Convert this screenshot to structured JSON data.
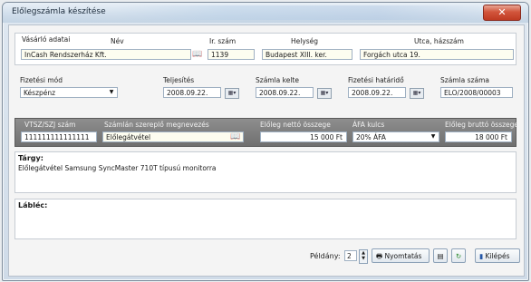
{
  "window": {
    "title": "Előlegszámla készítése",
    "close_glyph": "✕"
  },
  "buyer": {
    "section_label": "Vásárló adatai",
    "col_name": "Név",
    "col_zip": "Ir. szám",
    "col_city": "Helység",
    "col_street": "Utca, házszám",
    "name": "InCash Rendszerház Kft.",
    "zip": "1139",
    "city": "Budapest XIII. ker.",
    "street": "Forgách utca 19."
  },
  "payment": {
    "method_label": "Fizetési mód",
    "method_value": "Készpénz",
    "fulfillment_label": "Teljesítés",
    "fulfillment_value": "2008.09.22.",
    "issue_label": "Számla kelte",
    "issue_value": "2008.09.22.",
    "due_label": "Fizetési határidő",
    "due_value": "2008.09.22.",
    "number_label": "Számla száma",
    "number_value": "ELO/2008/00003"
  },
  "line": {
    "vtsz_label": "VTSZ/SZJ szám",
    "vtsz_value": "111111111111111",
    "desc_label": "Számlán szereplő megnevezés",
    "desc_value": "Előlegátvétel",
    "net_label": "Előleg nettó összege",
    "net_value": "15 000 Ft",
    "vat_label": "ÁFA kulcs",
    "vat_value": "20% ÁFA",
    "gross_label": "Előleg bruttó összege",
    "gross_value": "18 000 Ft"
  },
  "subject": {
    "label": "Tárgy:",
    "text": "Előlegátvétel Samsung SyncMaster 710T típusú monitorra"
  },
  "footer": {
    "label": "Lábléc:",
    "text": ""
  },
  "bottom": {
    "copies_label": "Példány:",
    "copies_value": "2",
    "print_label": "Nyomtatás",
    "exit_label": "Kilépés"
  },
  "icons": [
    "close-icon",
    "book-lookup-icon",
    "calendar-icon",
    "dropdown-arrow-icon",
    "spin-up-icon",
    "spin-down-icon",
    "printer-icon",
    "preview-icon",
    "refresh-icon",
    "exit-door-icon"
  ]
}
